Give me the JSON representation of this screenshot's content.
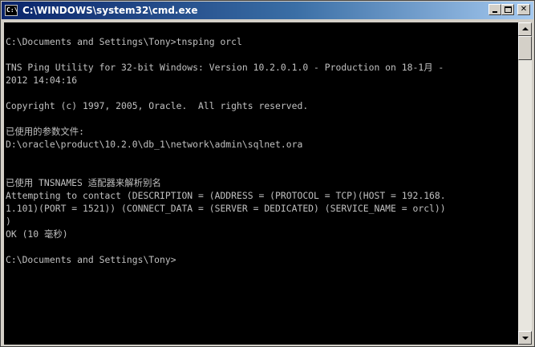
{
  "window": {
    "title": "C:\\WINDOWS\\system32\\cmd.exe",
    "icon_text": "C:\\"
  },
  "console": {
    "lines": [
      "",
      "C:\\Documents and Settings\\Tony>tnsping orcl",
      "",
      "TNS Ping Utility for 32-bit Windows: Version 10.2.0.1.0 - Production on 18-1月 -",
      "2012 14:04:16",
      "",
      "Copyright (c) 1997, 2005, Oracle.  All rights reserved.",
      "",
      "已使用的参数文件:",
      "D:\\oracle\\product\\10.2.0\\db_1\\network\\admin\\sqlnet.ora",
      "",
      "",
      "已使用 TNSNAMES 适配器来解析别名",
      "Attempting to contact (DESCRIPTION = (ADDRESS = (PROTOCOL = TCP)(HOST = 192.168.",
      "1.101)(PORT = 1521)) (CONNECT_DATA = (SERVER = DEDICATED) (SERVICE_NAME = orcl))",
      ")",
      "OK (10 毫秒)",
      "",
      "C:\\Documents and Settings\\Tony>"
    ]
  },
  "colors": {
    "console_bg": "#000000",
    "console_fg": "#c0c0c0",
    "title_active_start": "#0a246a",
    "title_active_end": "#a6caf0"
  }
}
